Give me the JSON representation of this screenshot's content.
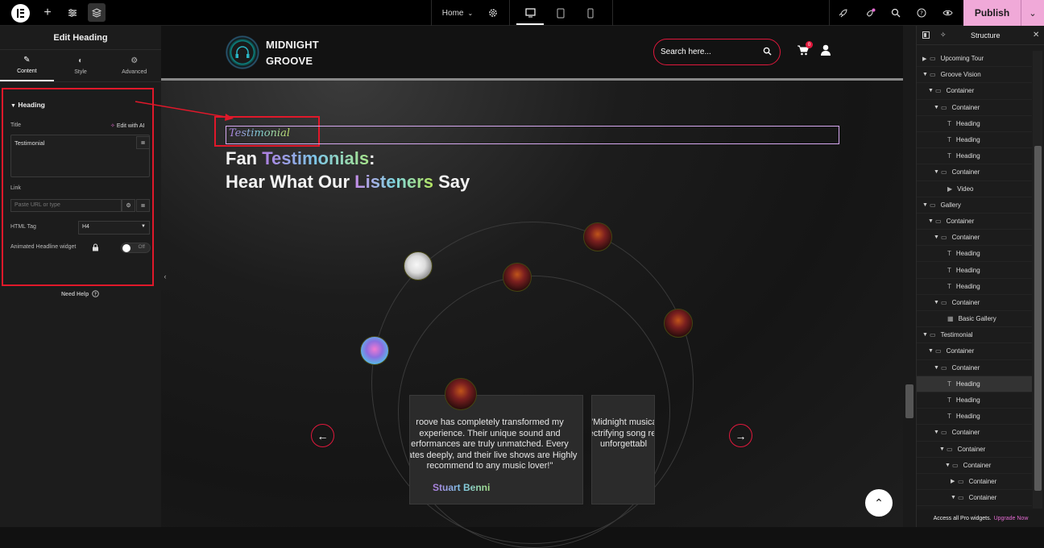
{
  "topbar": {
    "page_label": "Home",
    "publish_label": "Publish"
  },
  "left_panel": {
    "title": "Edit Heading",
    "tabs": [
      {
        "label": "Content",
        "icon": "pencil-icon"
      },
      {
        "label": "Style",
        "icon": "half-circle-icon"
      },
      {
        "label": "Advanced",
        "icon": "gear-icon"
      }
    ],
    "section_title": "Heading",
    "title_label": "Title",
    "edit_ai_label": "Edit with AI",
    "title_value": "Testimonial",
    "link_label": "Link",
    "link_placeholder": "Paste URL or type",
    "html_tag_label": "HTML Tag",
    "html_tag_value": "H4",
    "animated_label": "Animated Headline widget",
    "toggle_label": "Off",
    "need_help": "Need Help"
  },
  "site": {
    "brand_line1": "MIDNIGHT",
    "brand_line2": "GROOVE",
    "search_placeholder": "Search here...",
    "cart_count": "0",
    "eyebrow": "Testimonial",
    "heading_part1": "Fan ",
    "heading_grad1": "Testimonials",
    "heading_part2": ":",
    "heading_line2_a": "Hear What Our ",
    "heading_grad2": "Listeners",
    "heading_line2_b": " Say",
    "card1_text": "roove has completely transformed my experience. Their unique sound and erformances are truly unmatched. Every nates deeply, and their live shows are Highly recommend to any music lover!\"",
    "card1_name": "Stuart Benni",
    "card2_text": "\"Midnight musica electrifying song rese unforgettabl"
  },
  "structure_panel": {
    "title": "Structure",
    "footer_text": "Access all Pro widgets.",
    "footer_link": "Upgrade Now",
    "nodes": [
      {
        "label": "Upcoming Tour",
        "depth": 0,
        "caret": "right",
        "icon": "container"
      },
      {
        "label": "Groove Vision",
        "depth": 0,
        "caret": "down",
        "icon": "container"
      },
      {
        "label": "Container",
        "depth": 1,
        "caret": "down",
        "icon": "container"
      },
      {
        "label": "Container",
        "depth": 2,
        "caret": "down",
        "icon": "container"
      },
      {
        "label": "Heading",
        "depth": 3,
        "caret": "",
        "icon": "heading"
      },
      {
        "label": "Heading",
        "depth": 3,
        "caret": "",
        "icon": "heading"
      },
      {
        "label": "Heading",
        "depth": 3,
        "caret": "",
        "icon": "heading"
      },
      {
        "label": "Container",
        "depth": 2,
        "caret": "down",
        "icon": "container"
      },
      {
        "label": "Video",
        "depth": 3,
        "caret": "",
        "icon": "video"
      },
      {
        "label": "Gallery",
        "depth": 0,
        "caret": "down",
        "icon": "container"
      },
      {
        "label": "Container",
        "depth": 1,
        "caret": "down",
        "icon": "container"
      },
      {
        "label": "Container",
        "depth": 2,
        "caret": "down",
        "icon": "container"
      },
      {
        "label": "Heading",
        "depth": 3,
        "caret": "",
        "icon": "heading"
      },
      {
        "label": "Heading",
        "depth": 3,
        "caret": "",
        "icon": "heading"
      },
      {
        "label": "Heading",
        "depth": 3,
        "caret": "",
        "icon": "heading"
      },
      {
        "label": "Container",
        "depth": 2,
        "caret": "down",
        "icon": "container"
      },
      {
        "label": "Basic Gallery",
        "depth": 3,
        "caret": "",
        "icon": "gallery"
      },
      {
        "label": "Testimonial",
        "depth": 0,
        "caret": "down",
        "icon": "container"
      },
      {
        "label": "Container",
        "depth": 1,
        "caret": "down",
        "icon": "container"
      },
      {
        "label": "Container",
        "depth": 2,
        "caret": "down",
        "icon": "container"
      },
      {
        "label": "Heading",
        "depth": 3,
        "caret": "",
        "icon": "heading",
        "selected": true
      },
      {
        "label": "Heading",
        "depth": 3,
        "caret": "",
        "icon": "heading"
      },
      {
        "label": "Heading",
        "depth": 3,
        "caret": "",
        "icon": "heading"
      },
      {
        "label": "Container",
        "depth": 2,
        "caret": "down",
        "icon": "container"
      },
      {
        "label": "Container",
        "depth": 3,
        "caret": "down",
        "icon": "container"
      },
      {
        "label": "Container",
        "depth": 4,
        "caret": "down",
        "icon": "container"
      },
      {
        "label": "Container",
        "depth": 5,
        "caret": "right",
        "icon": "container"
      },
      {
        "label": "Container",
        "depth": 5,
        "caret": "down",
        "icon": "container"
      }
    ]
  }
}
